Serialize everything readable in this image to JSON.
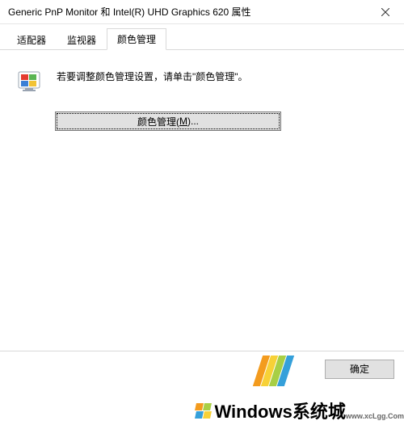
{
  "window": {
    "title": "Generic PnP Monitor 和 Intel(R) UHD Graphics 620 属性"
  },
  "tabs": [
    {
      "label": "适配器",
      "active": false
    },
    {
      "label": "监视器",
      "active": false
    },
    {
      "label": "颜色管理",
      "active": true
    }
  ],
  "content": {
    "description": "若要调整颜色管理设置，请单击\"颜色管理\"。",
    "button_prefix": "颜色管理(",
    "button_hotkey": "M",
    "button_suffix": ")..."
  },
  "footer": {
    "ok": "确定"
  },
  "watermark": {
    "brand_cn": "Windows系统城",
    "brand_en": "www.xcLgg.Com"
  },
  "colors": {
    "orange": "#f39b1e",
    "yellow": "#f7d137",
    "green": "#a8cf45",
    "blue": "#35a0da",
    "icon_r": "#e53a2e",
    "icon_g": "#5ab552",
    "icon_b": "#3a7fd5",
    "icon_y": "#f2c335"
  }
}
